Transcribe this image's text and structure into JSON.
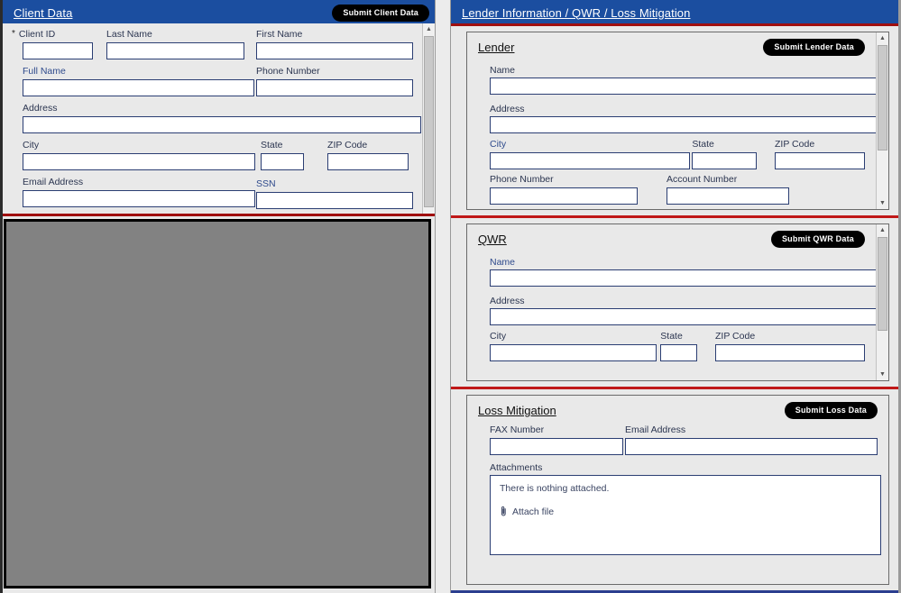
{
  "left_panel": {
    "header": {
      "title": "Client Data",
      "submit_label": "Submit Client Data"
    },
    "required_marker": "*",
    "fields": {
      "client_id": {
        "label": "Client ID",
        "value": "",
        "placeholder": ""
      },
      "last_name": {
        "label": "Last Name",
        "value": "",
        "placeholder": ""
      },
      "first_name": {
        "label": "First Name",
        "value": "",
        "placeholder": ""
      },
      "full_name": {
        "label": "Full Name",
        "value": "",
        "placeholder": ""
      },
      "phone_number": {
        "label": "Phone Number",
        "value": "",
        "placeholder": ""
      },
      "address": {
        "label": "Address",
        "value": "",
        "placeholder": ""
      },
      "city": {
        "label": "City",
        "value": "",
        "placeholder": ""
      },
      "state": {
        "label": "State",
        "value": "",
        "placeholder": ""
      },
      "zip_code": {
        "label": "ZIP Code",
        "value": "",
        "placeholder": ""
      },
      "email_address": {
        "label": "Email Address",
        "value": "",
        "placeholder": ""
      },
      "ssn": {
        "label": "SSN",
        "value": "",
        "placeholder": ""
      }
    },
    "document_viewer": {
      "content": ""
    }
  },
  "right_panel": {
    "header": {
      "title": "Lender Information / QWR / Loss Mitigation"
    },
    "sections": {
      "lender": {
        "title": "Lender",
        "submit_label": "Submit Lender Data",
        "fields": {
          "name": {
            "label": "Name",
            "value": ""
          },
          "address": {
            "label": "Address",
            "value": ""
          },
          "city": {
            "label": "City",
            "value": ""
          },
          "state": {
            "label": "State",
            "value": ""
          },
          "zip_code": {
            "label": "ZIP Code",
            "value": ""
          },
          "phone_number": {
            "label": "Phone Number",
            "value": ""
          },
          "account_number": {
            "label": "Account Number",
            "value": ""
          }
        }
      },
      "qwr": {
        "title": "QWR",
        "submit_label": "Submit QWR Data",
        "fields": {
          "name": {
            "label": "Name",
            "value": ""
          },
          "address": {
            "label": "Address",
            "value": ""
          },
          "city": {
            "label": "City",
            "value": ""
          },
          "state": {
            "label": "State",
            "value": ""
          },
          "zip_code": {
            "label": "ZIP Code",
            "value": ""
          }
        }
      },
      "loss_mitigation": {
        "title": "Loss Mitigation",
        "submit_label": "Submit Loss Data",
        "fields": {
          "fax_number": {
            "label": "FAX Number",
            "value": ""
          },
          "email_address": {
            "label": "Email Address",
            "value": ""
          },
          "attachments": {
            "label": "Attachments",
            "empty_text": "There is nothing attached.",
            "attach_link": "Attach file",
            "attach_icon": "paperclip-icon"
          }
        }
      }
    }
  },
  "colors": {
    "header_blue": "#1b4ea0",
    "divider_red": "#c01818",
    "panel_bg": "#e9e9e9",
    "field_border": "#2b3e73",
    "viewer_gray": "#828282",
    "button_black": "#000000"
  },
  "icons": {
    "scroll_up": "▲",
    "scroll_down": "▼"
  }
}
